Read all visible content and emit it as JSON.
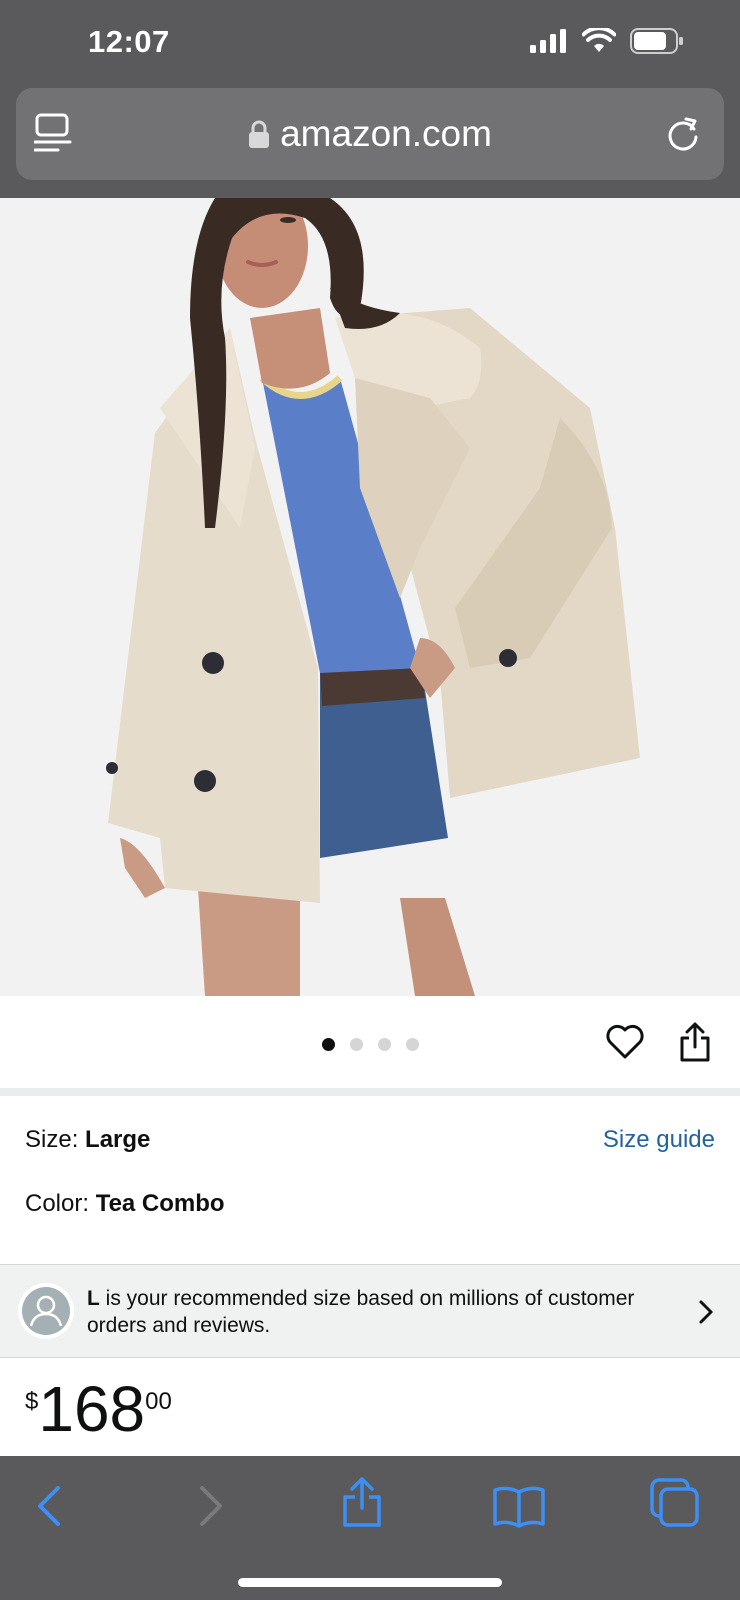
{
  "status_bar": {
    "time": "12:07"
  },
  "browser": {
    "url": "amazon.com"
  },
  "product": {
    "image_alt": "Woman wearing an oversized beige double-breasted coat over a blue tank top and denim shorts",
    "image_count": 4,
    "active_image_index": 0,
    "size_label": "Size: ",
    "size_value": "Large",
    "size_guide_label": "Size guide",
    "color_label": "Color: ",
    "color_value": "Tea Combo"
  },
  "recommendation": {
    "size_bold": "L",
    "text": " is your recommended size based on millions of customer orders and reviews."
  },
  "price": {
    "symbol": "$",
    "whole": "168",
    "fraction": "00"
  },
  "colors": {
    "chrome": "#5a5a5c",
    "link": "#2162a1",
    "toolbar_icon": "#3b8ff5"
  },
  "icons": {
    "menu": "reader-icon",
    "lock": "lock-icon",
    "reload": "reload-icon",
    "heart": "heart-icon",
    "share": "share-icon",
    "back": "back-arrow-icon",
    "forward": "forward-arrow-icon",
    "bottom_share": "share-icon",
    "bookmarks": "book-icon",
    "tabs": "tabs-icon"
  }
}
